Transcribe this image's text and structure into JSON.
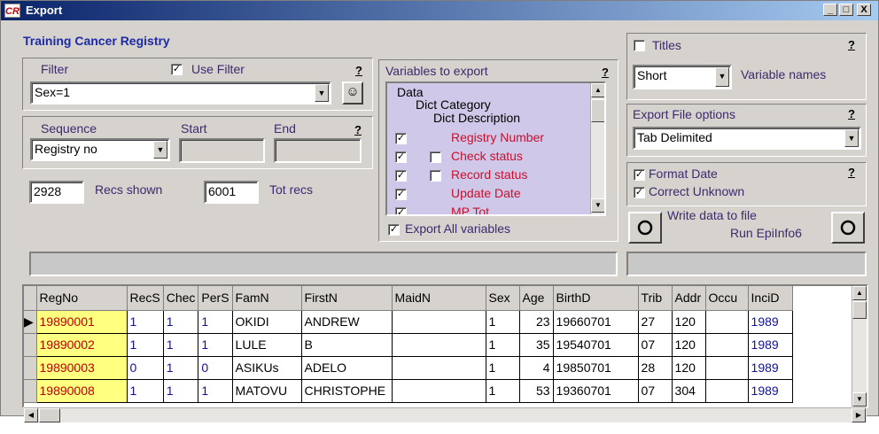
{
  "window": {
    "title": "Export",
    "app_icon": "CR",
    "controls": [
      "_",
      "□",
      "X"
    ]
  },
  "registry_name": "Training Cancer Registry",
  "filter": {
    "label": "Filter",
    "use_filter_label": "Use Filter",
    "use_filter_checked": true,
    "value": "Sex=1",
    "help": "?",
    "smiley_icon": "smiley-icon"
  },
  "sequence": {
    "label": "Sequence",
    "start_label": "Start",
    "end_label": "End",
    "value": "Registry no",
    "help": "?"
  },
  "recs": {
    "shown_value": "2928",
    "shown_label": "Recs shown",
    "total_value": "6001",
    "total_label": "Tot recs"
  },
  "variables": {
    "label": "Variables to export",
    "help": "?",
    "header_lines": [
      "Data",
      "Dict Category",
      "Dict Description"
    ],
    "items": [
      {
        "checked": true,
        "sub_checkbox": false,
        "sub_checked": false,
        "name": "Registry Number"
      },
      {
        "checked": true,
        "sub_checkbox": true,
        "sub_checked": false,
        "name": "Check status"
      },
      {
        "checked": true,
        "sub_checkbox": true,
        "sub_checked": false,
        "name": "Record status"
      },
      {
        "checked": true,
        "sub_checkbox": false,
        "sub_checked": false,
        "name": "Update Date"
      },
      {
        "checked": true,
        "sub_checkbox": false,
        "sub_checked": false,
        "name": "MP Tot"
      }
    ],
    "export_all_label": "Export All variables",
    "export_all_checked": true
  },
  "options": {
    "titles_label": "Titles",
    "titles_checked": false,
    "help": "?",
    "variable_names_value": "Short",
    "variable_names_label": "Variable names",
    "export_file_label": "Export File options",
    "export_file_value": "Tab Delimited",
    "format_date_label": "Format Date",
    "format_date_checked": true,
    "correct_unknown_label": "Correct Unknown",
    "correct_unknown_checked": true,
    "write_label": "Write data to file",
    "run_label": "Run EpiInfo6"
  },
  "grid": {
    "columns": [
      "RegNo",
      "RecS",
      "Chec",
      "PerS",
      "FamN",
      "FirstN",
      "MaidN",
      "Sex",
      "Age",
      "BirthD",
      "Trib",
      "Addr",
      "Occu",
      "InciD"
    ],
    "rows": [
      [
        "19890001",
        "1",
        "1",
        "1",
        "OKIDI",
        "ANDREW",
        "",
        "1",
        "23",
        "19660701",
        "27",
        "120",
        "",
        "1989"
      ],
      [
        "19890002",
        "1",
        "1",
        "1",
        "LULE",
        "B",
        "",
        "1",
        "35",
        "19540701",
        "07",
        "120",
        "",
        "1989"
      ],
      [
        "19890003",
        "0",
        "1",
        "0",
        "ASIKUs",
        "ADELO",
        "",
        "1",
        "4",
        "19850701",
        "28",
        "120",
        "",
        "1989"
      ],
      [
        "19890008",
        "1",
        "1",
        "1",
        "MATOVU",
        "CHRISTOPHE",
        "",
        "1",
        "53",
        "19360701",
        "07",
        "304",
        "",
        "1989"
      ]
    ]
  }
}
